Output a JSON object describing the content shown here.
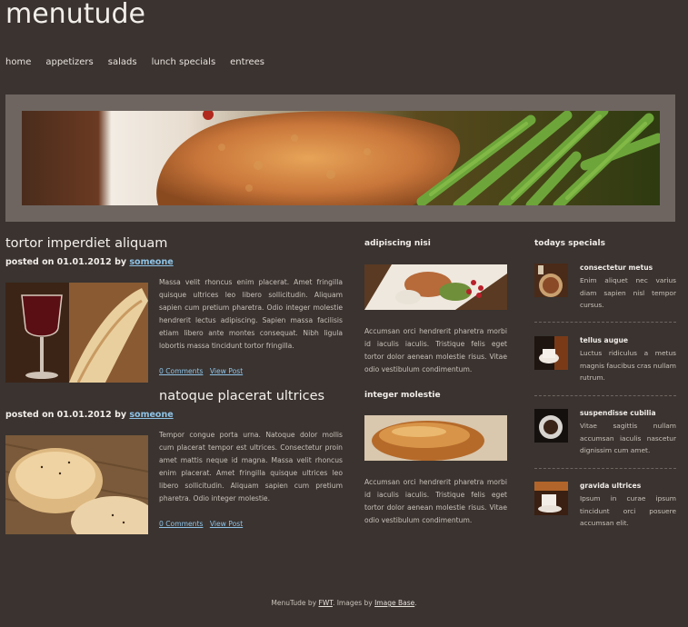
{
  "site": {
    "title": "menutude"
  },
  "nav": [
    "home",
    "appetizers",
    "salads",
    "lunch specials",
    "entrees"
  ],
  "posts": [
    {
      "title": "tortor imperdiet aliquam",
      "posted_on": "posted on 01.01.2012 by",
      "author": "someone",
      "text": "Massa velit rhoncus enim placerat. Amet fringilla quisque ultrices leo libero sollicitudin. Aliquam sapien cum pretium pharetra. Odio integer molestie hendrerit lectus adipiscing. Sapien massa facilisis etiam libero ante montes consequat. Nibh ligula lobortis massa tincidunt tortor fringilla.",
      "comments": "0 Comments",
      "view": "View Post"
    },
    {
      "title": "natoque placerat ultrices",
      "posted_on": "posted on 01.01.2012 by",
      "author": "someone",
      "text": "Tempor congue porta urna. Natoque dolor mollis cum placerat tempor est ultrices. Consectetur proin amet mattis neque id magna. Massa velit rhoncus enim placerat. Amet fringilla quisque ultrices leo libero sollicitudin. Aliquam sapien cum pretium pharetra. Odio integer molestie.",
      "comments": "0 Comments",
      "view": "View Post"
    }
  ],
  "middle": [
    {
      "title": "adipiscing nisi",
      "text": "Accumsan orci hendrerit pharetra morbi id iaculis iaculis. Tristique felis eget tortor dolor aenean molestie risus. Vitae odio vestibulum condimentum."
    },
    {
      "title": "integer molestie",
      "text": "Accumsan orci hendrerit pharetra morbi id iaculis iaculis. Tristique felis eget tortor dolor aenean molestie risus. Vitae odio vestibulum condimentum."
    }
  ],
  "specials": {
    "heading": "todays specials",
    "items": [
      {
        "title": "consectetur metus",
        "text": "Enim aliquet nec varius diam sapien nisl tempor cursus."
      },
      {
        "title": "tellus augue",
        "text": "Luctus ridiculus a metus magnis faucibus cras nullam rutrum."
      },
      {
        "title": "suspendisse cubilia",
        "text": "Vitae sagittis nullam accumsan iaculis nascetur dignissim cum amet."
      },
      {
        "title": "gravida ultrices",
        "text": "Ipsum in curae ipsum tincidunt orci posuere accumsan elit."
      }
    ]
  },
  "footer": {
    "text_a": "MenuTude by ",
    "link_a": "FWT",
    "text_b": ". Images by ",
    "link_b": "Image Base",
    "text_c": "."
  }
}
